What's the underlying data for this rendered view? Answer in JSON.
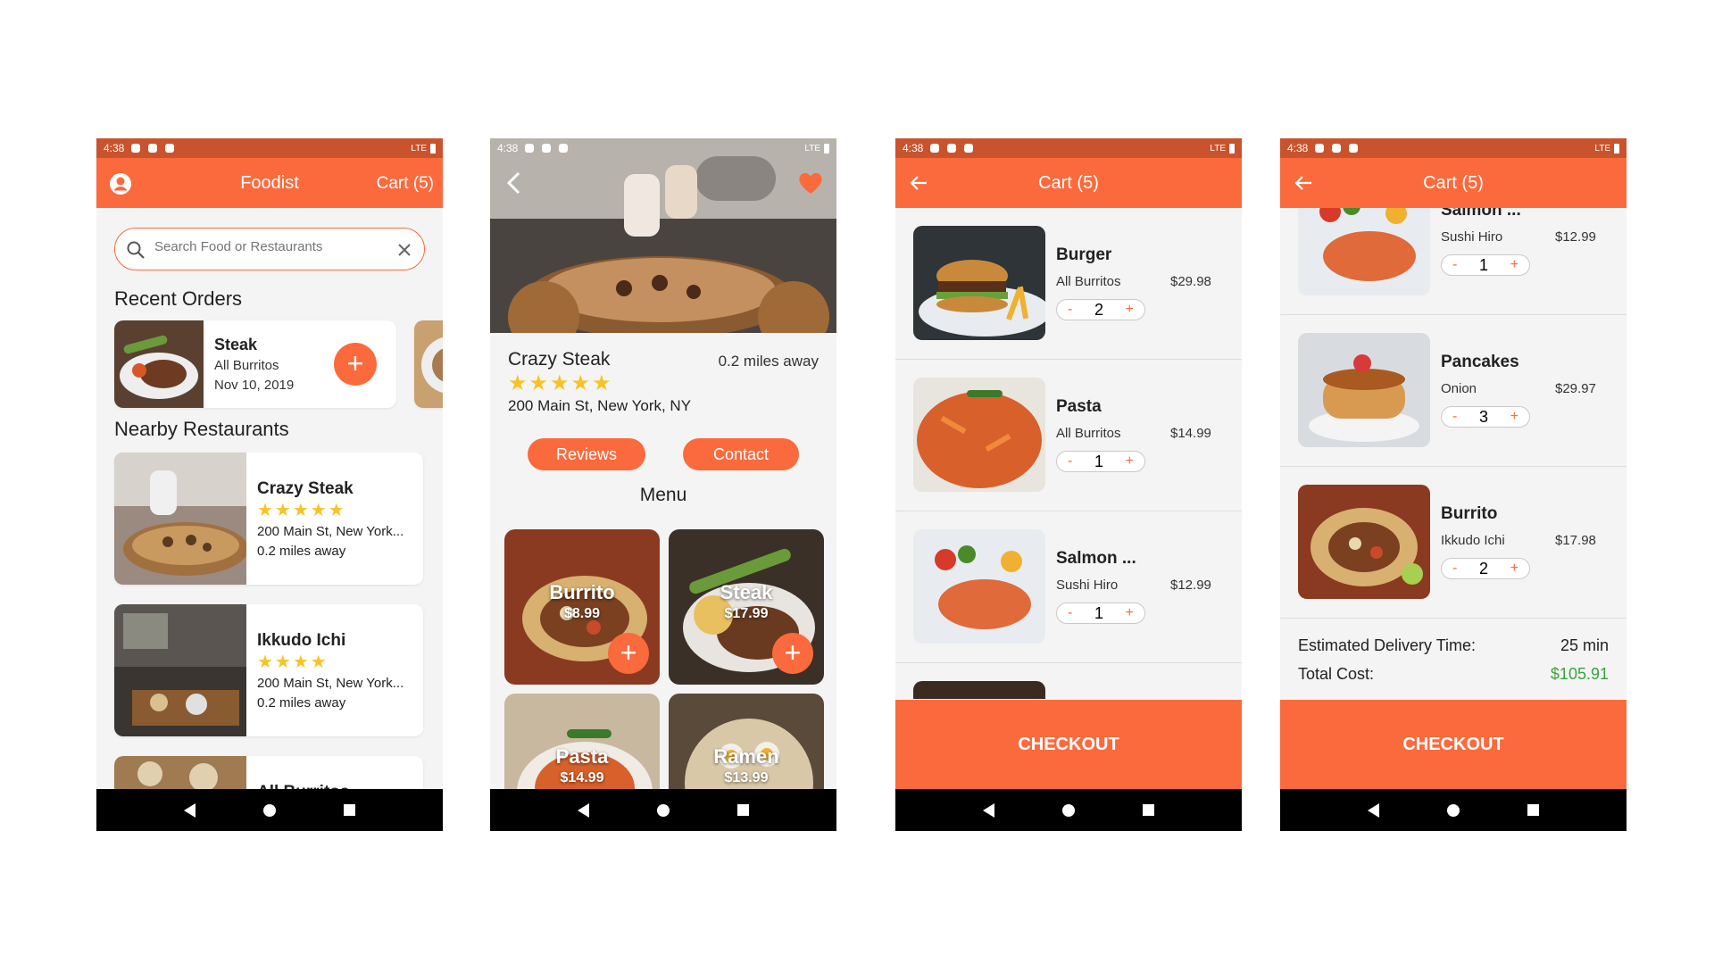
{
  "colors": {
    "accent": "#fb6a3c",
    "status_bar": "#c9532c",
    "star": "#f7c325",
    "total_green": "#3aa33a"
  },
  "status": {
    "time": "4:38",
    "network": "LTE"
  },
  "home": {
    "title": "Foodist",
    "cart_label": "Cart (5)",
    "search_placeholder": "Search Food or Restaurants",
    "recent_orders_heading": "Recent Orders",
    "recent_order": {
      "name": "Steak",
      "restaurant": "All Burritos",
      "date": "Nov 10, 2019"
    },
    "nearby_heading": "Nearby Restaurants",
    "nearby": [
      {
        "name": "Crazy Steak",
        "stars": "★★★★★",
        "address": "200 Main St, New York...",
        "distance": "0.2 miles away"
      },
      {
        "name": "Ikkudo Ichi",
        "stars": "★★★★",
        "address": "200 Main St, New York...",
        "distance": "0.2 miles away"
      },
      {
        "name": "All Burritos"
      }
    ]
  },
  "restaurant": {
    "name": "Crazy Steak",
    "distance": "0.2 miles away",
    "stars": "★★★★★",
    "address": "200 Main St, New York, NY",
    "reviews_label": "Reviews",
    "contact_label": "Contact",
    "menu_heading": "Menu",
    "menu": [
      {
        "name": "Burrito",
        "price": "$8.99"
      },
      {
        "name": "Steak",
        "price": "$17.99"
      },
      {
        "name": "Pasta",
        "price": "$14.99"
      },
      {
        "name": "Ramen",
        "price": "$13.99"
      }
    ]
  },
  "cart1": {
    "title": "Cart (5)",
    "items": [
      {
        "name": "Burger",
        "restaurant": "All Burritos",
        "price": "$29.98",
        "qty": "2"
      },
      {
        "name": "Pasta",
        "restaurant": "All Burritos",
        "price": "$14.99",
        "qty": "1"
      },
      {
        "name": "Salmon ...",
        "restaurant": "Sushi Hiro",
        "price": "$12.99",
        "qty": "1"
      }
    ],
    "checkout_label": "CHECKOUT"
  },
  "cart2": {
    "title": "Cart (5)",
    "items": [
      {
        "name": "Salmon ...",
        "restaurant": "Sushi Hiro",
        "price": "$12.99",
        "qty": "1"
      },
      {
        "name": "Pancakes",
        "restaurant": "Onion",
        "price": "$29.97",
        "qty": "3"
      },
      {
        "name": "Burrito",
        "restaurant": "Ikkudo Ichi",
        "price": "$17.98",
        "qty": "2"
      }
    ],
    "delivery_label": "Estimated Delivery Time:",
    "delivery_value": "25 min",
    "total_label": "Total Cost:",
    "total_value": "$105.91",
    "checkout_label": "CHECKOUT"
  },
  "common": {
    "minus": "-",
    "plus": "+",
    "plus_big": "+"
  }
}
